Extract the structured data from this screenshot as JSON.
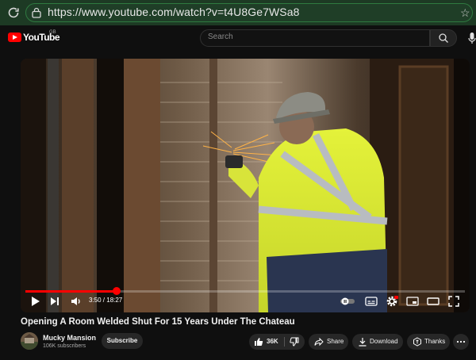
{
  "browser": {
    "url": "https://www.youtube.com/watch?v=t4U8Ge7WSa8"
  },
  "youtube": {
    "logo_text": "YouTube",
    "region": "GB",
    "search_placeholder": "Search"
  },
  "player": {
    "current_time": "3:50",
    "duration": "18:27",
    "time_display": "3:50 / 18:27",
    "progress_fraction": 0.208
  },
  "video": {
    "title": "Opening A Room Welded Shut For 15 Years Under The Chateau",
    "channel": "Mucky Mansion",
    "subscribers": "106K subscribers",
    "subscribe_label": "Subscribe",
    "likes": "36K",
    "share_label": "Share",
    "download_label": "Download",
    "thanks_label": "Thanks"
  },
  "colors": {
    "accent": "#ff0000",
    "browser_bar": "#1d3a24",
    "page_bg": "#0f0f0f",
    "pill_bg": "#272727"
  }
}
